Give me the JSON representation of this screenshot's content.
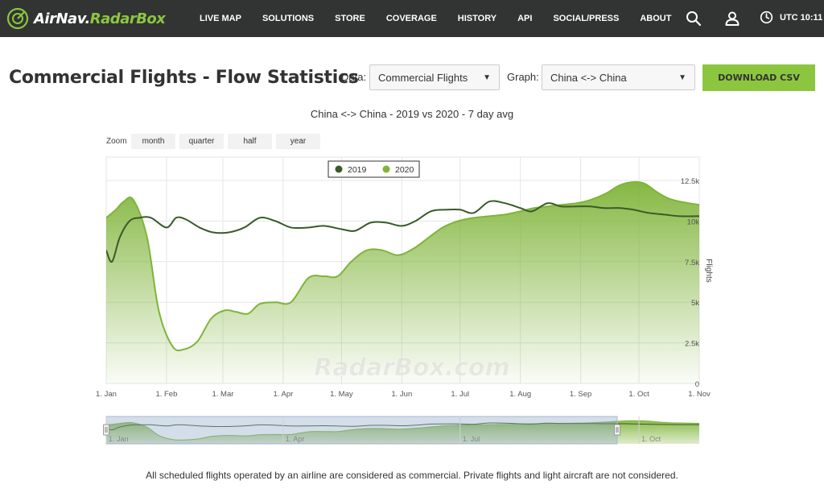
{
  "nav": {
    "logo": {
      "part1": "AirNav.",
      "part2": "RadarBox"
    },
    "links": [
      "LIVE MAP",
      "SOLUTIONS",
      "STORE",
      "COVERAGE",
      "HISTORY",
      "API",
      "SOCIAL/PRESS",
      "ABOUT"
    ],
    "icons": [
      "search-icon",
      "user-icon",
      "clock-icon"
    ],
    "utc": "UTC 10:11"
  },
  "header": {
    "title": "Commercial Flights - Flow Statistics",
    "data_label": "Data:",
    "data_value": "Commercial Flights",
    "graph_label": "Graph:",
    "graph_value": "China <-> China",
    "download_label": "DOWNLOAD CSV"
  },
  "zoom": {
    "label": "Zoom",
    "buttons": [
      "month",
      "quarter",
      "half",
      "year"
    ]
  },
  "watermark": "RadarBox.com",
  "footnote": "All scheduled flights operated by an airline are considered as commercial. Private flights and light aircraft are not considered.",
  "colors": {
    "accent": "#8cc63f",
    "series2019": "#3a5a2a",
    "series2020": "#7fb439",
    "nav_bg": "#313433"
  },
  "chart_data": {
    "type": "area",
    "title": "China <-> China - 2019 vs 2020 - 7 day avg",
    "ylabel": "Flights",
    "ylim": [
      0,
      12500
    ],
    "yticks": [
      0,
      2500,
      5000,
      7500,
      10000,
      12500
    ],
    "ytick_labels": [
      "0",
      "2.5k",
      "5k",
      "7.5k",
      "10k",
      "12.5k"
    ],
    "xlim": [
      "2020-01-01",
      "2020-11-01"
    ],
    "xticks": [
      "2020-01-01",
      "2020-02-01",
      "2020-03-01",
      "2020-04-01",
      "2020-05-01",
      "2020-06-01",
      "2020-07-01",
      "2020-08-01",
      "2020-09-01",
      "2020-10-01",
      "2020-11-01"
    ],
    "xtick_labels": [
      "1. Jan",
      "1. Feb",
      "1. Mar",
      "1. Apr",
      "1. May",
      "1. Jun",
      "1. Jul",
      "1. Aug",
      "1. Sep",
      "1. Oct",
      "1. Nov"
    ],
    "navigator_labels": [
      "1. Jan",
      "1. Apr",
      "1. Jul",
      "1. Oct"
    ],
    "legend_position": "top-center",
    "grid": true,
    "series": [
      {
        "name": "2019",
        "type": "line",
        "x": [
          "2020-01-01",
          "2020-01-04",
          "2020-01-08",
          "2020-01-13",
          "2020-01-18",
          "2020-01-24",
          "2020-02-01",
          "2020-02-06",
          "2020-02-11",
          "2020-02-18",
          "2020-02-25",
          "2020-03-04",
          "2020-03-12",
          "2020-03-20",
          "2020-03-28",
          "2020-04-05",
          "2020-04-14",
          "2020-04-22",
          "2020-05-01",
          "2020-05-08",
          "2020-05-16",
          "2020-05-24",
          "2020-06-01",
          "2020-06-08",
          "2020-06-16",
          "2020-06-24",
          "2020-07-01",
          "2020-07-08",
          "2020-07-16",
          "2020-07-24",
          "2020-08-01",
          "2020-08-07",
          "2020-08-15",
          "2020-08-22",
          "2020-08-30",
          "2020-09-06",
          "2020-09-13",
          "2020-09-21",
          "2020-09-28",
          "2020-10-06",
          "2020-10-14",
          "2020-10-22",
          "2020-11-01"
        ],
        "values": [
          8200,
          7500,
          9000,
          10000,
          10200,
          10200,
          9600,
          10200,
          10100,
          9600,
          9300,
          9300,
          9600,
          10200,
          10000,
          9600,
          9600,
          9700,
          9500,
          9400,
          9900,
          9900,
          9700,
          10000,
          10600,
          10700,
          10700,
          10500,
          11200,
          11100,
          10800,
          10600,
          11100,
          10900,
          10900,
          10900,
          10800,
          10800,
          10700,
          10500,
          10400,
          10300,
          10300
        ]
      },
      {
        "name": "2020",
        "type": "area",
        "x": [
          "2020-01-01",
          "2020-01-06",
          "2020-01-10",
          "2020-01-15",
          "2020-01-22",
          "2020-01-28",
          "2020-02-04",
          "2020-02-10",
          "2020-02-17",
          "2020-02-24",
          "2020-03-02",
          "2020-03-08",
          "2020-03-14",
          "2020-03-20",
          "2020-03-28",
          "2020-04-05",
          "2020-04-14",
          "2020-04-22",
          "2020-04-29",
          "2020-05-06",
          "2020-05-14",
          "2020-05-22",
          "2020-05-30",
          "2020-06-07",
          "2020-06-15",
          "2020-06-22",
          "2020-06-30",
          "2020-07-08",
          "2020-07-16",
          "2020-07-24",
          "2020-08-01",
          "2020-08-08",
          "2020-08-15",
          "2020-08-22",
          "2020-08-30",
          "2020-09-06",
          "2020-09-14",
          "2020-09-21",
          "2020-09-28",
          "2020-10-04",
          "2020-10-10",
          "2020-10-16",
          "2020-10-22",
          "2020-11-01"
        ],
        "values": [
          10200,
          10700,
          11200,
          11300,
          9000,
          4500,
          2300,
          2100,
          2600,
          4000,
          4500,
          4400,
          4300,
          4900,
          5000,
          5000,
          6500,
          6600,
          6600,
          7500,
          8200,
          8200,
          7900,
          8300,
          9000,
          9600,
          10000,
          10200,
          10300,
          10400,
          10600,
          10800,
          10900,
          11000,
          11100,
          11300,
          11700,
          12200,
          12400,
          12300,
          11800,
          11400,
          11200,
          11000
        ]
      }
    ]
  }
}
